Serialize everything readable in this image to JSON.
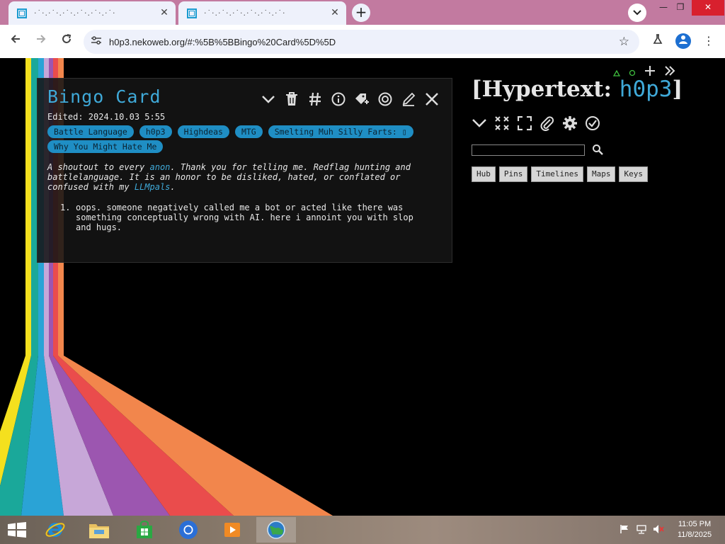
{
  "browser": {
    "tabs": [
      {
        "title": "·˙·.·˙·.·˙·.·˙·.·˙·.·˙·"
      },
      {
        "title": "·˙·.·˙·.·˙·.·˙·.·˙·.·˙·"
      }
    ],
    "tab_close_glyph": "✕",
    "new_tab_glyph": "+",
    "url": "h0p3.nekoweb.org/#:%5B%5BBingo%20Card%5D%5D",
    "minimize_glyph": "—",
    "restore_glyph": "❐",
    "close_glyph": "✕"
  },
  "card": {
    "title": "Bingo Card",
    "edited": "Edited: 2024.10.03 5:55",
    "tags": [
      "Battle Language",
      "h0p3",
      "Highdeas",
      "MTG",
      "Smelting Muh Silly Farts: ▯",
      "Why You Might Hate Me"
    ],
    "intro": {
      "part1": "A shoutout to every ",
      "link1": "anon",
      "part2": ". Thank you for telling me. Redflag hunting and battlelanguage. It is an honor to be disliked, hated, or conflated or confused with my ",
      "link2": "LLMpals",
      "part3": "."
    },
    "list": [
      {
        "num": "1.",
        "text": "oops. someone negatively called me a bot or acted like there was something conceptually wrong with AI. here i annoint you with slop and hugs."
      }
    ]
  },
  "sidebar": {
    "title_prefix": "[Hypertext: ",
    "title_name": "h0p3",
    "title_suffix": "]",
    "nav_buttons": [
      "Hub",
      "Pins",
      "Timelines",
      "Maps",
      "Keys"
    ],
    "search_value": ""
  },
  "taskbar": {
    "time": "11:05 PM",
    "date": "11/8/2025"
  },
  "colors": {
    "accent": "#3fa9d8",
    "tag_bg": "#1f8ec4",
    "tabstrip": "#c27aa0"
  }
}
